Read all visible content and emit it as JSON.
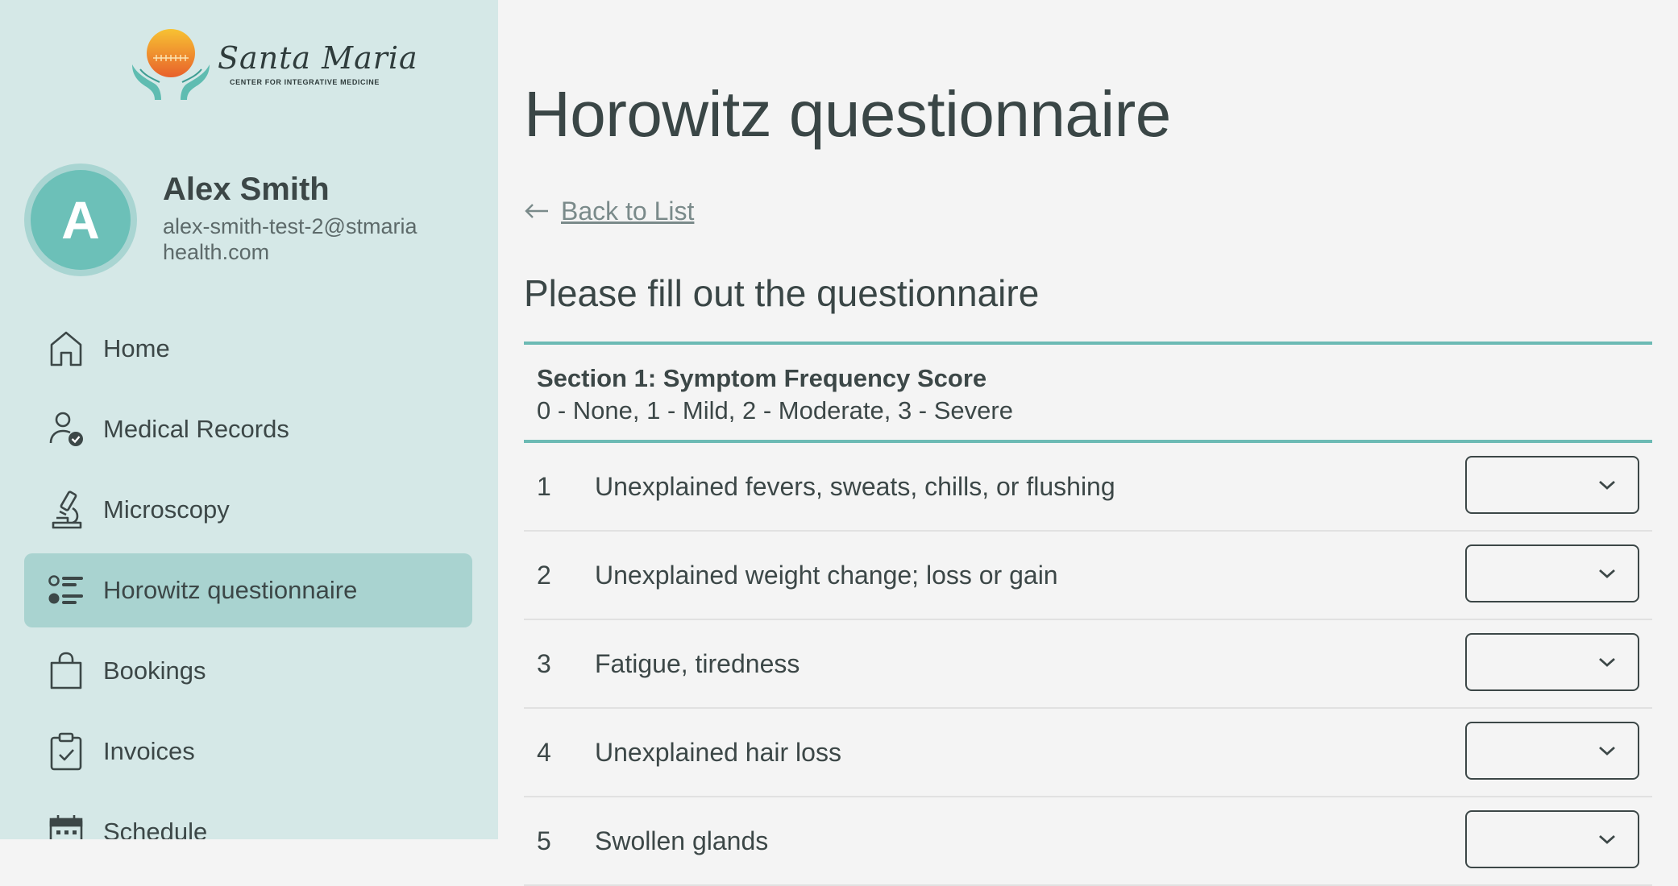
{
  "brand": {
    "name": "Santa Maria",
    "tagline": "CENTER FOR INTEGRATIVE MEDICINE",
    "colors": {
      "teal": "#6cc0b8",
      "sidebar_bg": "#d5e8e7",
      "active_bg": "#a9d3d0",
      "accent_line": "#6cbab4"
    }
  },
  "user": {
    "initial": "A",
    "name": "Alex Smith",
    "email": "alex-smith-test-2@stmariahealth.com"
  },
  "nav": {
    "items": [
      {
        "label": "Home",
        "icon": "home-icon",
        "active": false
      },
      {
        "label": "Medical Records",
        "icon": "user-check-icon",
        "active": false
      },
      {
        "label": "Microscopy",
        "icon": "microscope-icon",
        "active": false
      },
      {
        "label": "Horowitz questionnaire",
        "icon": "list-icon",
        "active": true
      },
      {
        "label": "Bookings",
        "icon": "shopping-bag-icon",
        "active": false
      },
      {
        "label": "Invoices",
        "icon": "clipboard-check-icon",
        "active": false
      },
      {
        "label": "Schedule",
        "icon": "calendar-icon",
        "active": false
      }
    ]
  },
  "main": {
    "title": "Horowitz questionnaire",
    "back_label": "Back to List",
    "back_icon": "arrow-left-icon",
    "form_title": "Please fill out the questionnaire",
    "section": {
      "title": "Section 1: Symptom Frequency Score",
      "scale": "0 - None, 1 - Mild, 2 - Moderate, 3 - Severe"
    },
    "questions": [
      {
        "num": "1",
        "text": "Unexplained fevers, sweats, chills, or flushing",
        "value": ""
      },
      {
        "num": "2",
        "text": "Unexplained weight change; loss or gain",
        "value": ""
      },
      {
        "num": "3",
        "text": "Fatigue, tiredness",
        "value": ""
      },
      {
        "num": "4",
        "text": "Unexplained hair loss",
        "value": ""
      },
      {
        "num": "5",
        "text": "Swollen glands",
        "value": ""
      }
    ]
  }
}
